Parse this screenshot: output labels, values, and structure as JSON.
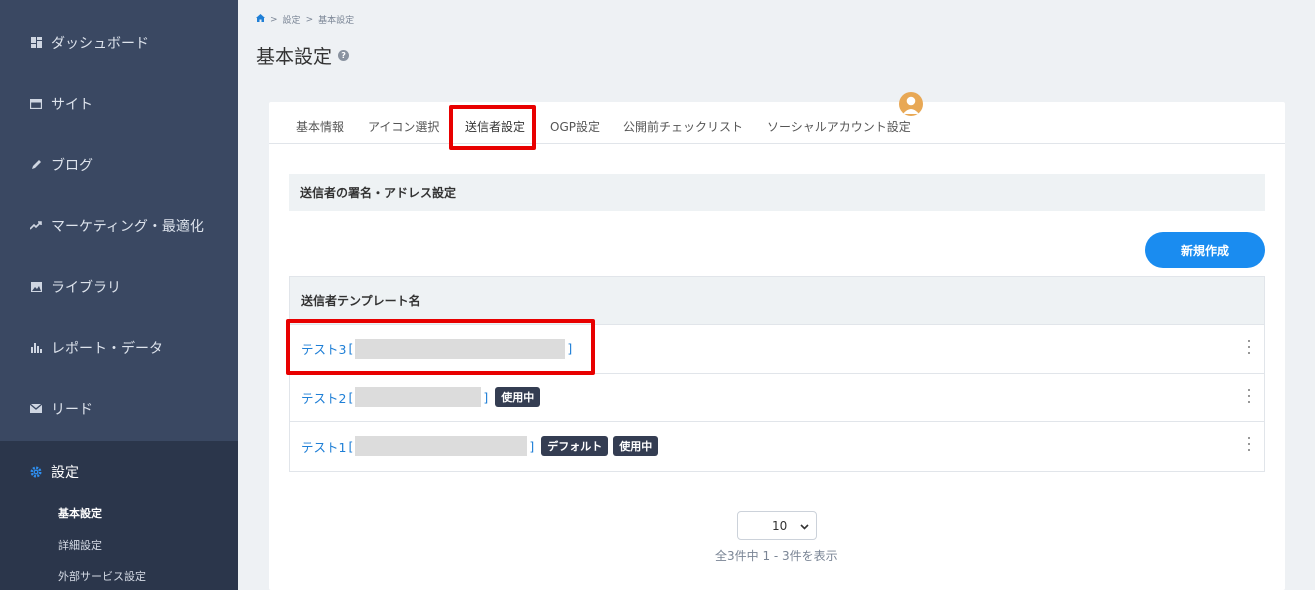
{
  "sidebar": {
    "items": [
      {
        "label": "ダッシュボード",
        "icon": "dashboard-icon"
      },
      {
        "label": "サイト",
        "icon": "site-icon"
      },
      {
        "label": "ブログ",
        "icon": "pencil-icon"
      },
      {
        "label": "マーケティング・最適化",
        "icon": "trend-icon"
      },
      {
        "label": "ライブラリ",
        "icon": "image-icon"
      },
      {
        "label": "レポート・データ",
        "icon": "bar-chart-icon"
      },
      {
        "label": "リード",
        "icon": "mail-icon"
      },
      {
        "label": "設定",
        "icon": "gear-icon"
      }
    ],
    "sub_items": [
      "基本設定",
      "詳細設定",
      "外部サービス設定"
    ]
  },
  "breadcrumb": {
    "home_icon": "home-icon",
    "sep": ">",
    "items": [
      "設定",
      "基本設定"
    ]
  },
  "page": {
    "title": "基本設定",
    "help_icon": "question-icon"
  },
  "tabs": [
    "基本情報",
    "アイコン選択",
    "送信者設定",
    "OGP設定",
    "公開前チェックリスト",
    "ソーシャルアカウント設定"
  ],
  "section": {
    "title": "送信者の署名・アドレス設定"
  },
  "new_button": {
    "label": "新規作成"
  },
  "table": {
    "header": "送信者テンプレート名",
    "rows": [
      {
        "name": "テスト3",
        "open": "[",
        "close": "]",
        "badges": []
      },
      {
        "name": "テスト2",
        "open": "[",
        "close": "]",
        "badges": [
          "使用中"
        ]
      },
      {
        "name": "テスト1",
        "open": "[",
        "close": "]",
        "badges": [
          "デフォルト",
          "使用中"
        ]
      }
    ]
  },
  "pagination": {
    "per_page": "10",
    "info": "全3件中 1 - 3件を表示"
  },
  "colors": {
    "sidebar": "#3a4862",
    "accent": "#1a8cf0",
    "highlight": "#e80000",
    "badge": "#343d52"
  }
}
